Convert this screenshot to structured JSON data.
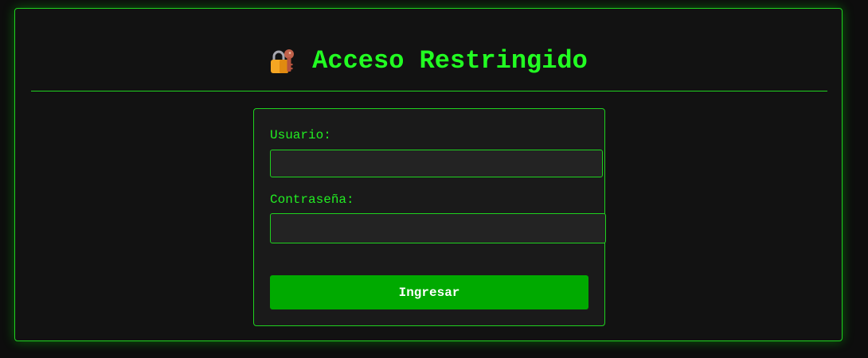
{
  "header": {
    "icon": "lock-with-key-icon",
    "title": "Acceso Restringido"
  },
  "form": {
    "username_label": "Usuario:",
    "username_value": "",
    "password_label": "Contraseña:",
    "password_value": "",
    "submit_label": "Ingresar"
  },
  "colors": {
    "accent": "#22ff22",
    "border": "#1fd11f",
    "button": "#00aa00",
    "background": "#121212"
  }
}
